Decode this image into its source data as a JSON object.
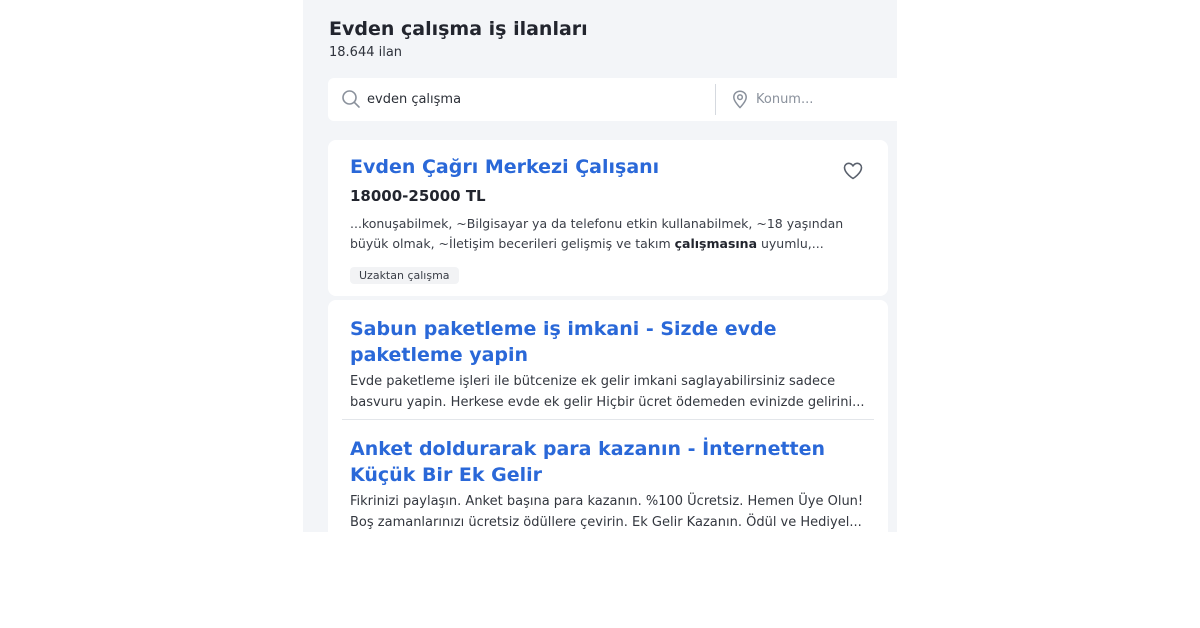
{
  "header": {
    "title": "Evden çalışma iş ilanları",
    "count": "18.644 ilan"
  },
  "search": {
    "query": "evden çalışma",
    "location_placeholder": "Konum...",
    "search_icon": "search-icon",
    "location_icon": "location-pin-icon"
  },
  "job": {
    "title": "Evden Çağrı Merkezi Çalışanı",
    "salary": "18000-25000 TL",
    "snippet_before": "...konuşabilmek, ~Bilgisayar ya da telefonu etkin kullanabilmek, ~18 yaşından büyük olmak, ~İletişim becerileri gelişmiş ve takım ",
    "snippet_bold": "çalışmasına",
    "snippet_after": " uyumlu,...",
    "tag": "Uzaktan çalışma",
    "favorite_icon": "heart-icon"
  },
  "ads": [
    {
      "title": "Sabun paketleme iş imkani - Sizde evde paketleme yapin",
      "description": "Evde paketleme işleri ile bütcenize ek gelir imkani saglayabilirsiniz sadece basvuru yapin. Herkese evde ek gelir Hiçbir ücret ödemeden evinizde gelirini..."
    },
    {
      "title": "Anket doldurarak para kazanın - İnternetten Küçük Bir Ek Gelir",
      "description": "Fikrinizi paylaşın. Anket başına para kazanın. %100 Ücretsiz. Hemen Üye Olun! Boş zamanlarınızı ücretsiz ödüllere çevirin. Ek Gelir Kazanın. Ödül ve Hediyel..."
    }
  ],
  "colors": {
    "accent": "#2a68d8",
    "panel_bg": "#f3f5f8",
    "text": "#22252e"
  }
}
